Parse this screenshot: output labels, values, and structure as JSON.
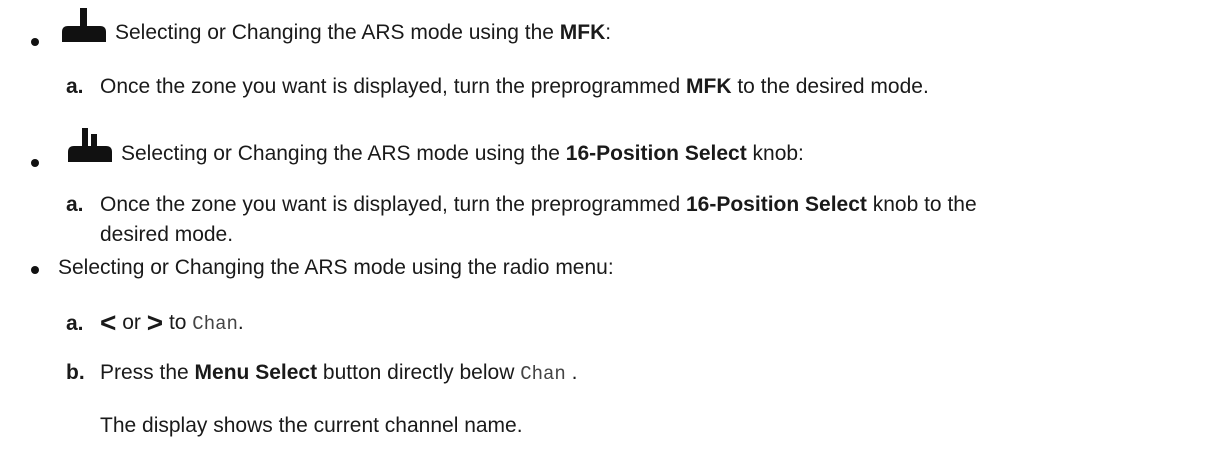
{
  "items": [
    {
      "icon": "single-knob-radio-icon",
      "text_pre": "Selecting or Changing the ARS mode using the ",
      "text_bold": "MFK",
      "text_post": ":",
      "steps": [
        {
          "letter": "a.",
          "pre": "Once the zone you want is displayed, turn the preprogrammed ",
          "bold": "MFK",
          "post": " to the desired mode."
        }
      ]
    },
    {
      "icon": "double-knob-radio-icon",
      "text_pre": "Selecting or Changing the ARS mode using the ",
      "text_bold": "16-Position Select",
      "text_post": " knob:",
      "steps": [
        {
          "letter": "a.",
          "pre": "Once the zone you want is displayed, turn the preprogrammed ",
          "bold": "16-Position Select",
          "post": " knob to the",
          "line2": "desired mode."
        }
      ]
    },
    {
      "text": "Selecting or Changing the ARS mode using the radio menu:",
      "steps": [
        {
          "letter": "a.",
          "left_arrow": "<",
          "or": "or",
          "right_arrow": ">",
          "to": "to",
          "mono": "Chan",
          "post": "."
        },
        {
          "letter": "b.",
          "pre": "Press the ",
          "bold": "Menu Select",
          "mid": " button directly below ",
          "mono": "Chan",
          "post": ".",
          "result": "The display shows the current channel name."
        }
      ]
    }
  ]
}
